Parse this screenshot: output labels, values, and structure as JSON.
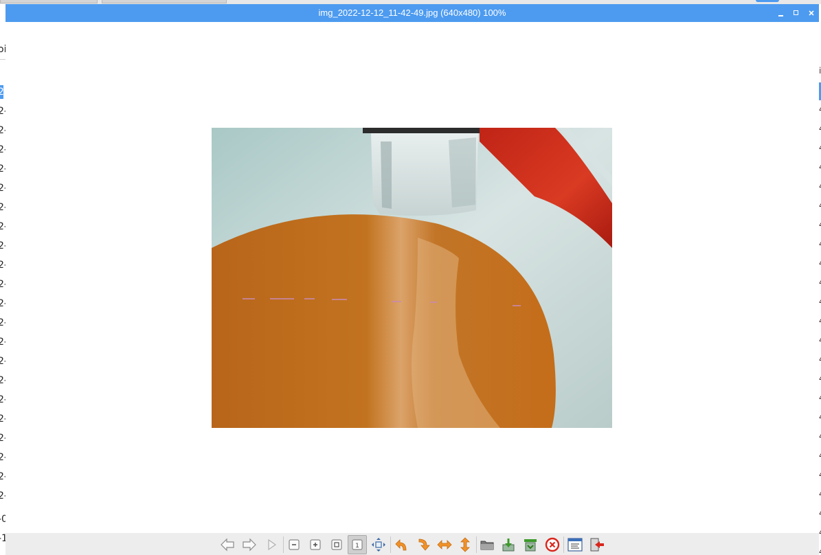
{
  "window": {
    "title": "img_2022-12-12_11-42-49.jpg (640x480) 100%"
  },
  "background_file_list": {
    "left_fragments": [
      "oi",
      "2-",
      "2-",
      "2-",
      "2-",
      "2-",
      "2-",
      "2-",
      "2-",
      "2-",
      "2-",
      "2-",
      "2-",
      "2-",
      "2-",
      "2-",
      "2-",
      "2-",
      "2-",
      "2-",
      "2-",
      "2-",
      "2-",
      "-0",
      "-1"
    ],
    "right_fragments": [
      "i",
      "4",
      "4",
      "4",
      "4",
      "4",
      "4",
      "4",
      "4",
      "4",
      "4",
      "4",
      "4",
      "4",
      "4",
      "4",
      "4",
      "4",
      "4",
      "4",
      "4",
      "4",
      "4",
      "4",
      "4"
    ]
  },
  "toolbar": {
    "buttons": [
      {
        "name": "previous-image-button",
        "icon": "arrow-left-icon"
      },
      {
        "name": "next-image-button",
        "icon": "arrow-right-icon"
      },
      {
        "name": "slideshow-button",
        "icon": "play-icon"
      },
      {
        "name": "zoom-out-button",
        "icon": "zoom-out-icon"
      },
      {
        "name": "zoom-in-button",
        "icon": "zoom-in-icon"
      },
      {
        "name": "fit-window-button",
        "icon": "fit-window-icon"
      },
      {
        "name": "original-size-button",
        "icon": "original-size-icon",
        "active": true
      },
      {
        "name": "fullscreen-button",
        "icon": "fullscreen-icon"
      },
      {
        "name": "rotate-left-button",
        "icon": "rotate-ccw-icon"
      },
      {
        "name": "rotate-right-button",
        "icon": "rotate-cw-icon"
      },
      {
        "name": "flip-horizontal-button",
        "icon": "flip-horizontal-icon"
      },
      {
        "name": "flip-vertical-button",
        "icon": "flip-vertical-icon"
      },
      {
        "name": "open-file-button",
        "icon": "folder-icon"
      },
      {
        "name": "save-file-button",
        "icon": "save-icon"
      },
      {
        "name": "save-as-button",
        "icon": "save-as-icon"
      },
      {
        "name": "delete-file-button",
        "icon": "delete-icon"
      },
      {
        "name": "preferences-button",
        "icon": "preferences-icon"
      },
      {
        "name": "quit-button",
        "icon": "exit-icon"
      }
    ]
  },
  "colors": {
    "titlebar": "#4d9bf0",
    "toolbar": "#ededed",
    "icon_orange": "#f0922a",
    "icon_green": "#3c9a2a",
    "icon_red": "#d9261c",
    "icon_gray": "#8a8a8a"
  }
}
